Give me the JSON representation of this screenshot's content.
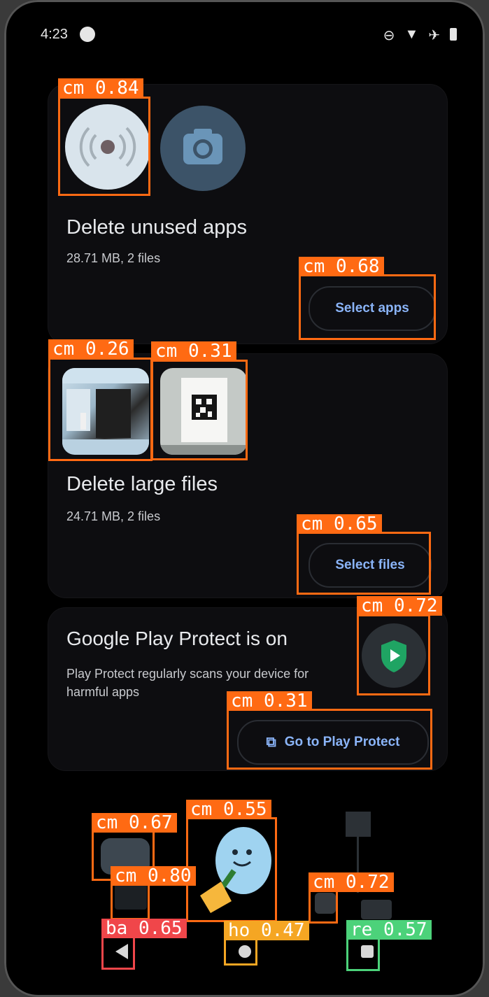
{
  "status_bar": {
    "time": "4:23",
    "icons": [
      "media-icon",
      "dnd-icon",
      "wifi-icon",
      "airplane-icon",
      "battery-icon"
    ]
  },
  "unused_apps": {
    "title": "Delete unused apps",
    "subtitle": "28.71 MB, 2 files",
    "button": "Select apps"
  },
  "large_files": {
    "title": "Delete large files",
    "subtitle": "24.71 MB, 2 files",
    "button": "Select files"
  },
  "play_protect": {
    "title": "Google Play Protect is on",
    "description_line1": "Play Protect regularly scans your device for",
    "description_line2": "harmful apps",
    "button": "Go to Play Protect"
  },
  "detections": [
    {
      "label": "cm  0.84"
    },
    {
      "label": "cm  0.68"
    },
    {
      "label": "cm  0.26"
    },
    {
      "label": "cm  0.31"
    },
    {
      "label": "cm  0.65"
    },
    {
      "label": "cm  0.72"
    },
    {
      "label": "cm  0.31"
    },
    {
      "label": "cm  0.67"
    },
    {
      "label": "cm  0.55"
    },
    {
      "label": "cm  0.80"
    },
    {
      "label": "cm  0.72"
    },
    {
      "label": "ba  0.65"
    },
    {
      "label": "ho  0.47"
    },
    {
      "label": "re  0.57"
    }
  ],
  "colors": {
    "background": "#000000",
    "accent": "#8ab4f8",
    "overlay_orange": "#ff6a13",
    "overlay_red": "#f0464a",
    "overlay_amber": "#f5a623",
    "overlay_green": "#4cd27a"
  }
}
